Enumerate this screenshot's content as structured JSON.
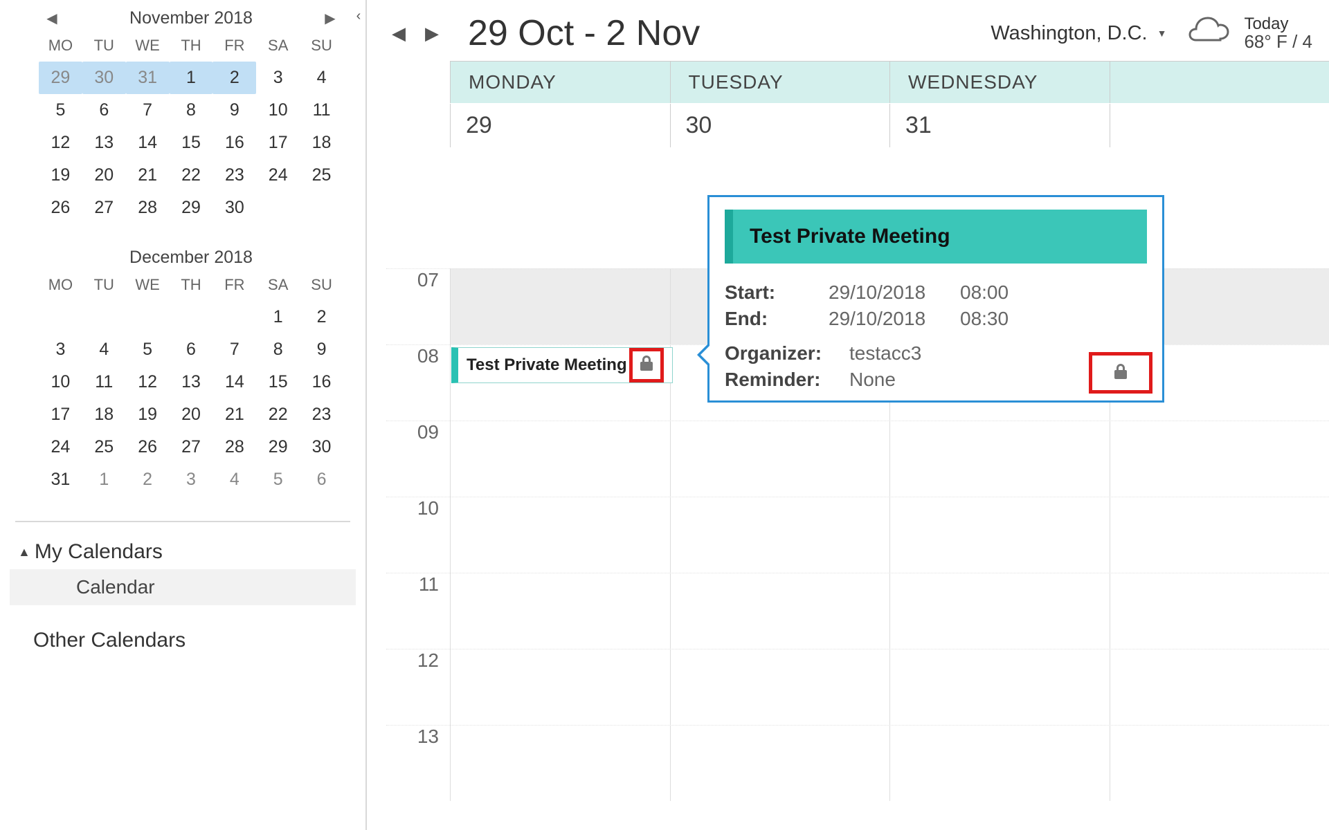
{
  "sidebar": {
    "collapse_icon": "‹",
    "cal1": {
      "title": "November 2018",
      "prev": "◀",
      "next": "▶",
      "dow": [
        "MO",
        "TU",
        "WE",
        "TH",
        "FR",
        "SA",
        "SU"
      ],
      "rows": [
        [
          {
            "n": "29",
            "sel": true,
            "other": true
          },
          {
            "n": "30",
            "sel": true,
            "other": true
          },
          {
            "n": "31",
            "sel": true,
            "other": true
          },
          {
            "n": "1",
            "sel": true
          },
          {
            "n": "2",
            "sel": true
          },
          {
            "n": "3"
          },
          {
            "n": "4"
          }
        ],
        [
          {
            "n": "5"
          },
          {
            "n": "6"
          },
          {
            "n": "7"
          },
          {
            "n": "8"
          },
          {
            "n": "9"
          },
          {
            "n": "10"
          },
          {
            "n": "11"
          }
        ],
        [
          {
            "n": "12"
          },
          {
            "n": "13"
          },
          {
            "n": "14"
          },
          {
            "n": "15"
          },
          {
            "n": "16"
          },
          {
            "n": "17"
          },
          {
            "n": "18"
          }
        ],
        [
          {
            "n": "19"
          },
          {
            "n": "20"
          },
          {
            "n": "21"
          },
          {
            "n": "22"
          },
          {
            "n": "23"
          },
          {
            "n": "24"
          },
          {
            "n": "25"
          }
        ],
        [
          {
            "n": "26"
          },
          {
            "n": "27"
          },
          {
            "n": "28"
          },
          {
            "n": "29"
          },
          {
            "n": "30"
          },
          {
            "n": ""
          },
          {
            "n": ""
          }
        ]
      ]
    },
    "cal2": {
      "title": "December 2018",
      "dow": [
        "MO",
        "TU",
        "WE",
        "TH",
        "FR",
        "SA",
        "SU"
      ],
      "rows": [
        [
          {
            "n": ""
          },
          {
            "n": ""
          },
          {
            "n": ""
          },
          {
            "n": ""
          },
          {
            "n": ""
          },
          {
            "n": "1"
          },
          {
            "n": "2"
          }
        ],
        [
          {
            "n": "3"
          },
          {
            "n": "4"
          },
          {
            "n": "5"
          },
          {
            "n": "6"
          },
          {
            "n": "7"
          },
          {
            "n": "8"
          },
          {
            "n": "9"
          }
        ],
        [
          {
            "n": "10"
          },
          {
            "n": "11"
          },
          {
            "n": "12"
          },
          {
            "n": "13"
          },
          {
            "n": "14"
          },
          {
            "n": "15"
          },
          {
            "n": "16"
          }
        ],
        [
          {
            "n": "17"
          },
          {
            "n": "18"
          },
          {
            "n": "19"
          },
          {
            "n": "20"
          },
          {
            "n": "21"
          },
          {
            "n": "22"
          },
          {
            "n": "23"
          }
        ],
        [
          {
            "n": "24"
          },
          {
            "n": "25"
          },
          {
            "n": "26"
          },
          {
            "n": "27"
          },
          {
            "n": "28"
          },
          {
            "n": "29"
          },
          {
            "n": "30"
          }
        ],
        [
          {
            "n": "31"
          },
          {
            "n": "1",
            "other": true
          },
          {
            "n": "2",
            "other": true
          },
          {
            "n": "3",
            "other": true
          },
          {
            "n": "4",
            "other": true
          },
          {
            "n": "5",
            "other": true
          },
          {
            "n": "6",
            "other": true
          }
        ]
      ]
    },
    "my_calendars_label": "My Calendars",
    "calendar_item": "Calendar",
    "other_calendars_label": "Other Calendars"
  },
  "topbar": {
    "prev": "◀",
    "next": "▶",
    "range": "29 Oct - 2 Nov",
    "location": "Washington,  D.C.",
    "today_label": "Today",
    "temps": "68° F / 4"
  },
  "grid": {
    "day_headers": [
      "MONDAY",
      "TUESDAY",
      "WEDNESDAY",
      ""
    ],
    "dates": [
      "29",
      "30",
      "31",
      ""
    ],
    "hours": [
      "07",
      "08",
      "09",
      "10",
      "11",
      "12",
      "13"
    ]
  },
  "event": {
    "title": "Test Private Meeting"
  },
  "popover": {
    "title": "Test Private Meeting",
    "start_label": "Start:",
    "start_date": "29/10/2018",
    "start_time": "08:00",
    "end_label": "End:",
    "end_date": "29/10/2018",
    "end_time": "08:30",
    "organizer_label": "Organizer:",
    "organizer": "testacc3",
    "reminder_label": "Reminder:",
    "reminder": "None"
  }
}
